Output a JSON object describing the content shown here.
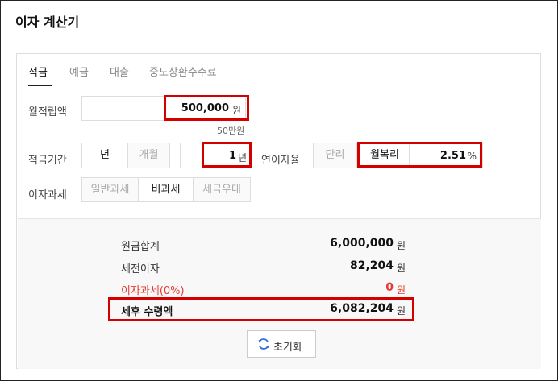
{
  "window": {
    "title": "이자 계산기"
  },
  "tabs": [
    "적금",
    "예금",
    "대출",
    "중도상환수수료"
  ],
  "form": {
    "monthly_label": "월적립액",
    "monthly_value": "500,000",
    "won_unit": "원",
    "monthly_hint": "50만원",
    "period_label": "적금기간",
    "period_year": "년",
    "period_month": "개월",
    "period_value": "1",
    "period_unit": "년",
    "rate_label": "연이자율",
    "rate_simple": "단리",
    "rate_compound": "월복리",
    "rate_value": "2.51",
    "rate_unit": "%",
    "tax_label": "이자과세",
    "tax_general": "일반과세",
    "tax_none": "비과세",
    "tax_preferred": "세금우대"
  },
  "results": {
    "principal_label": "원금합계",
    "principal_value": "6,000,000",
    "pretax_label": "세전이자",
    "pretax_value": "82,204",
    "tax_label": "이자과세(0%)",
    "tax_value": "0",
    "net_label": "세후 수령액",
    "net_value": "6,082,204",
    "unit": "원"
  },
  "reset_label": "초기화",
  "colors": {
    "highlight": "#d40000",
    "tax_red": "#e53935",
    "reset_icon": "#2f6fd6"
  }
}
